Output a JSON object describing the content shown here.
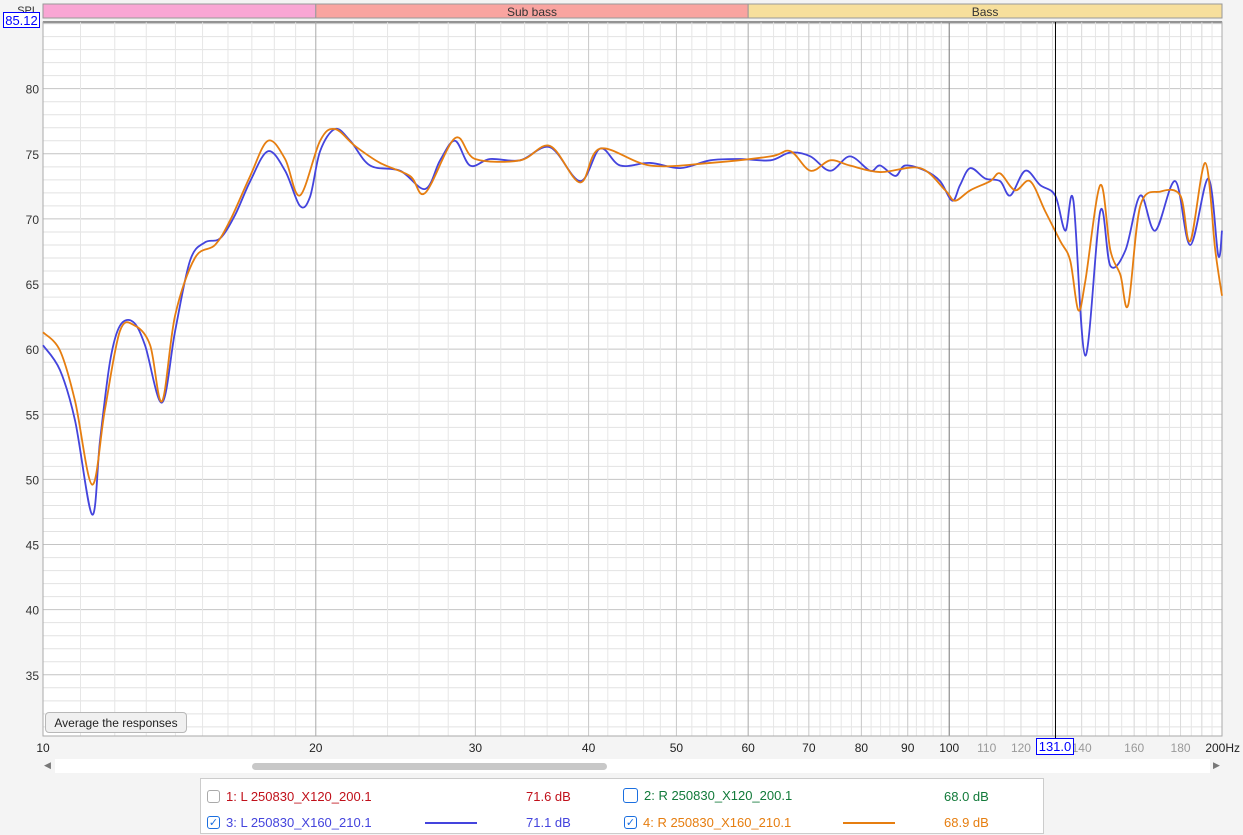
{
  "chart_data": {
    "type": "line",
    "ylabel": "SPL",
    "xunit": "Hz",
    "xscale": "log",
    "xlim": [
      10,
      200
    ],
    "ylim": [
      30.3,
      85.12
    ],
    "yticks": [
      35,
      40,
      45,
      50,
      55,
      60,
      65,
      70,
      75,
      80
    ],
    "xticks_major": [
      "10",
      "20",
      "30",
      "40",
      "50",
      "60",
      "70",
      "80",
      "90",
      "100"
    ],
    "xticks_minor": [
      "110",
      "120",
      "140",
      "160",
      "180"
    ],
    "xtick_end": "200Hz",
    "grid": true,
    "bands": [
      {
        "label": "",
        "from": 10,
        "to": 20,
        "color": "#f9a6d4"
      },
      {
        "label": "Sub bass",
        "from": 20,
        "to": 60,
        "color": "#f9a4a0"
      },
      {
        "label": "Bass",
        "from": 60,
        "to": 200,
        "color": "#f7df9c"
      }
    ],
    "cursor": {
      "x_label": "131.0",
      "x": 131.0,
      "y_label": "85.12"
    },
    "series": [
      {
        "name": "3: L 250830_X160_210.1",
        "color": "#4444dd",
        "points": [
          [
            10,
            60.3
          ],
          [
            10.44,
            58.4
          ],
          [
            10.85,
            54.5
          ],
          [
            11.33,
            47.3
          ],
          [
            11.56,
            53
          ],
          [
            11.86,
            59.1
          ],
          [
            12.16,
            61.8
          ],
          [
            12.57,
            62.1
          ],
          [
            12.96,
            60.3
          ],
          [
            13.53,
            55.9
          ],
          [
            13.99,
            61.4
          ],
          [
            14.53,
            66.8
          ],
          [
            15.09,
            68.2
          ],
          [
            15.68,
            68.5
          ],
          [
            16.29,
            70.3
          ],
          [
            16.93,
            72.9
          ],
          [
            17.71,
            75.2
          ],
          [
            18.5,
            73.7
          ],
          [
            19.21,
            71
          ],
          [
            19.71,
            71.7
          ],
          [
            20.22,
            75.2
          ],
          [
            21.0,
            76.9
          ],
          [
            21.83,
            76
          ],
          [
            22.96,
            74.1
          ],
          [
            24.78,
            73.7
          ],
          [
            26.41,
            72.3
          ],
          [
            27.43,
            74.5
          ],
          [
            28.49,
            76
          ],
          [
            29.6,
            74.1
          ],
          [
            31.14,
            74.6
          ],
          [
            33.62,
            74.5
          ],
          [
            36.27,
            75.5
          ],
          [
            39.15,
            72.9
          ],
          [
            41.19,
            75.4
          ],
          [
            43.35,
            74.1
          ],
          [
            46.77,
            74.3
          ],
          [
            50.5,
            73.9
          ],
          [
            54.5,
            74.5
          ],
          [
            58.8,
            74.6
          ],
          [
            63.5,
            74.5
          ],
          [
            66.8,
            75.1
          ],
          [
            70.3,
            74.8
          ],
          [
            73.9,
            73.7
          ],
          [
            77.7,
            74.8
          ],
          [
            81.8,
            73.7
          ],
          [
            83.9,
            74.1
          ],
          [
            87.2,
            73.3
          ],
          [
            89.4,
            74.1
          ],
          [
            94.1,
            73.7
          ],
          [
            97.7,
            72.9
          ],
          [
            100.8,
            71.4
          ],
          [
            102.8,
            72.6
          ],
          [
            105.5,
            73.9
          ],
          [
            109.6,
            73.1
          ],
          [
            113.8,
            72.9
          ],
          [
            116.8,
            71.8
          ],
          [
            121.3,
            73.7
          ],
          [
            126.0,
            72.6
          ],
          [
            130.9,
            71.8
          ],
          [
            134.3,
            69.1
          ],
          [
            137.1,
            71.4
          ],
          [
            141.3,
            59.5
          ],
          [
            146.8,
            70.6
          ],
          [
            150.6,
            66.4
          ],
          [
            156.5,
            67.6
          ],
          [
            162.5,
            71.8
          ],
          [
            168.8,
            69.1
          ],
          [
            177.6,
            72.9
          ],
          [
            184.5,
            68
          ],
          [
            193.2,
            73.1
          ],
          [
            198.1,
            67.2
          ],
          [
            200,
            69.1
          ]
        ]
      },
      {
        "name": "4: R 250830_X160_210.1",
        "color": "#e67e10",
        "points": [
          [
            10,
            61.3
          ],
          [
            10.44,
            59.9
          ],
          [
            10.85,
            56
          ],
          [
            11.33,
            49.6
          ],
          [
            11.7,
            55.3
          ],
          [
            12.16,
            61.4
          ],
          [
            12.63,
            61.8
          ],
          [
            13.13,
            60.3
          ],
          [
            13.53,
            56
          ],
          [
            13.99,
            62.6
          ],
          [
            14.71,
            67
          ],
          [
            15.48,
            68
          ],
          [
            16.09,
            69.9
          ],
          [
            16.93,
            73.3
          ],
          [
            17.71,
            76
          ],
          [
            18.5,
            74.6
          ],
          [
            19.21,
            71.8
          ],
          [
            20.22,
            76
          ],
          [
            21.0,
            76.9
          ],
          [
            22.1,
            75.6
          ],
          [
            23.55,
            74.3
          ],
          [
            25.41,
            73.3
          ],
          [
            26.41,
            72
          ],
          [
            28.49,
            76.2
          ],
          [
            29.98,
            74.6
          ],
          [
            33.62,
            74.5
          ],
          [
            36.27,
            75.6
          ],
          [
            39.15,
            72.8
          ],
          [
            41.19,
            75.4
          ],
          [
            46.77,
            74.1
          ],
          [
            54.5,
            74.3
          ],
          [
            63.5,
            74.8
          ],
          [
            66.8,
            75.2
          ],
          [
            70.3,
            73.7
          ],
          [
            73.9,
            74.5
          ],
          [
            77.7,
            74.1
          ],
          [
            83.9,
            73.6
          ],
          [
            92.9,
            73.9
          ],
          [
            99.0,
            72.2
          ],
          [
            101.5,
            71.4
          ],
          [
            105.5,
            72.2
          ],
          [
            111.0,
            72.9
          ],
          [
            113.8,
            73.5
          ],
          [
            118.2,
            72.2
          ],
          [
            122.8,
            72.9
          ],
          [
            127.6,
            70.6
          ],
          [
            132.6,
            68.3
          ],
          [
            136.0,
            66.8
          ],
          [
            138.8,
            63
          ],
          [
            141.3,
            65.2
          ],
          [
            146.8,
            72.6
          ],
          [
            150.6,
            67.6
          ],
          [
            154.5,
            65.7
          ],
          [
            157.6,
            63.4
          ],
          [
            162.5,
            71
          ],
          [
            171.0,
            72.1
          ],
          [
            179.9,
            71.8
          ],
          [
            184.5,
            68.3
          ],
          [
            191.7,
            74.3
          ],
          [
            196.6,
            67.6
          ],
          [
            200,
            64.1
          ]
        ]
      }
    ]
  },
  "controls": {
    "average_button": "Average the responses"
  },
  "legend": [
    {
      "label": "1: L 250830_X120_200.1",
      "value": "71.6 dB",
      "color": "#c0101a",
      "checked": false
    },
    {
      "label": "2: R 250830_X120_200.1",
      "value": "68.0 dB",
      "color": "#127a3a",
      "checked": false
    },
    {
      "label": "3: L 250830_X160_210.1",
      "value": "71.1 dB",
      "color": "#4444dd",
      "checked": true
    },
    {
      "label": "4: R 250830_X160_210.1",
      "value": "68.9 dB",
      "color": "#e67e10",
      "checked": true
    }
  ],
  "icons": {
    "check": "✓",
    "scroll_left": "◀",
    "scroll_right": "▶"
  }
}
